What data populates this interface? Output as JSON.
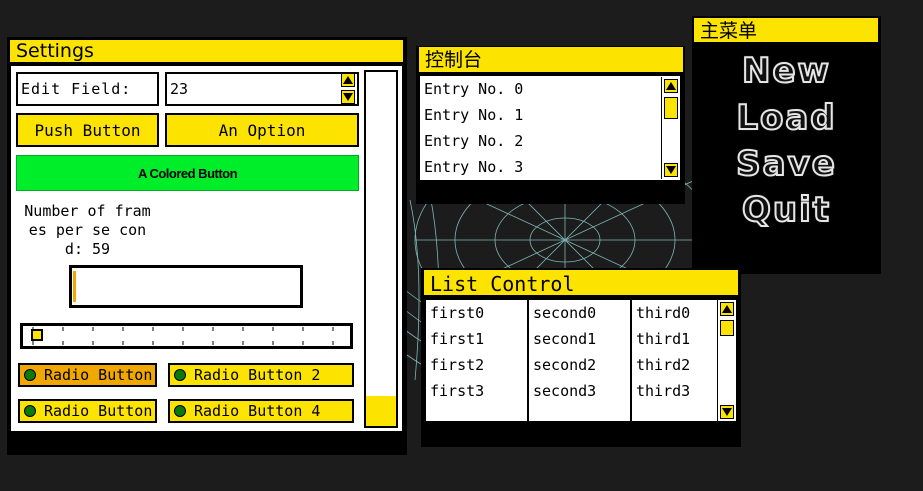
{
  "settings": {
    "title": "Settings",
    "edit_label": "Edit Field:",
    "edit_value": "23",
    "push_button": "Push Button",
    "option_button": "An Option",
    "colored_button": "A Colored Button",
    "colored_button_color": "#00ee2a",
    "fps_text": "Number of frames per se cond: 59",
    "slider_value": 0.03,
    "radios": [
      {
        "label": "Radio Button",
        "selected": true
      },
      {
        "label": "Radio Button 2",
        "selected": false
      },
      {
        "label": "Radio Button",
        "selected": false
      },
      {
        "label": "Radio Button 4",
        "selected": false
      }
    ]
  },
  "console": {
    "title": "控制台",
    "entries": [
      "Entry No. 0",
      "Entry No. 1",
      "Entry No. 2",
      "Entry No. 3"
    ]
  },
  "main_menu": {
    "title": "主菜单",
    "items": [
      "New",
      "Load",
      "Save",
      "Quit"
    ]
  },
  "list_control": {
    "title": "List Control",
    "columns": [
      [
        "first0",
        "first1",
        "first2",
        "first3"
      ],
      [
        "second0",
        "second1",
        "second2",
        "second3"
      ],
      [
        "third0",
        "third1",
        "third2",
        "third3"
      ]
    ]
  },
  "colors": {
    "accent_yellow": "#fde300",
    "window_bg": "#000000",
    "desktop_bg": "#1c1c1c",
    "wireframe": "#9fe8e8"
  }
}
